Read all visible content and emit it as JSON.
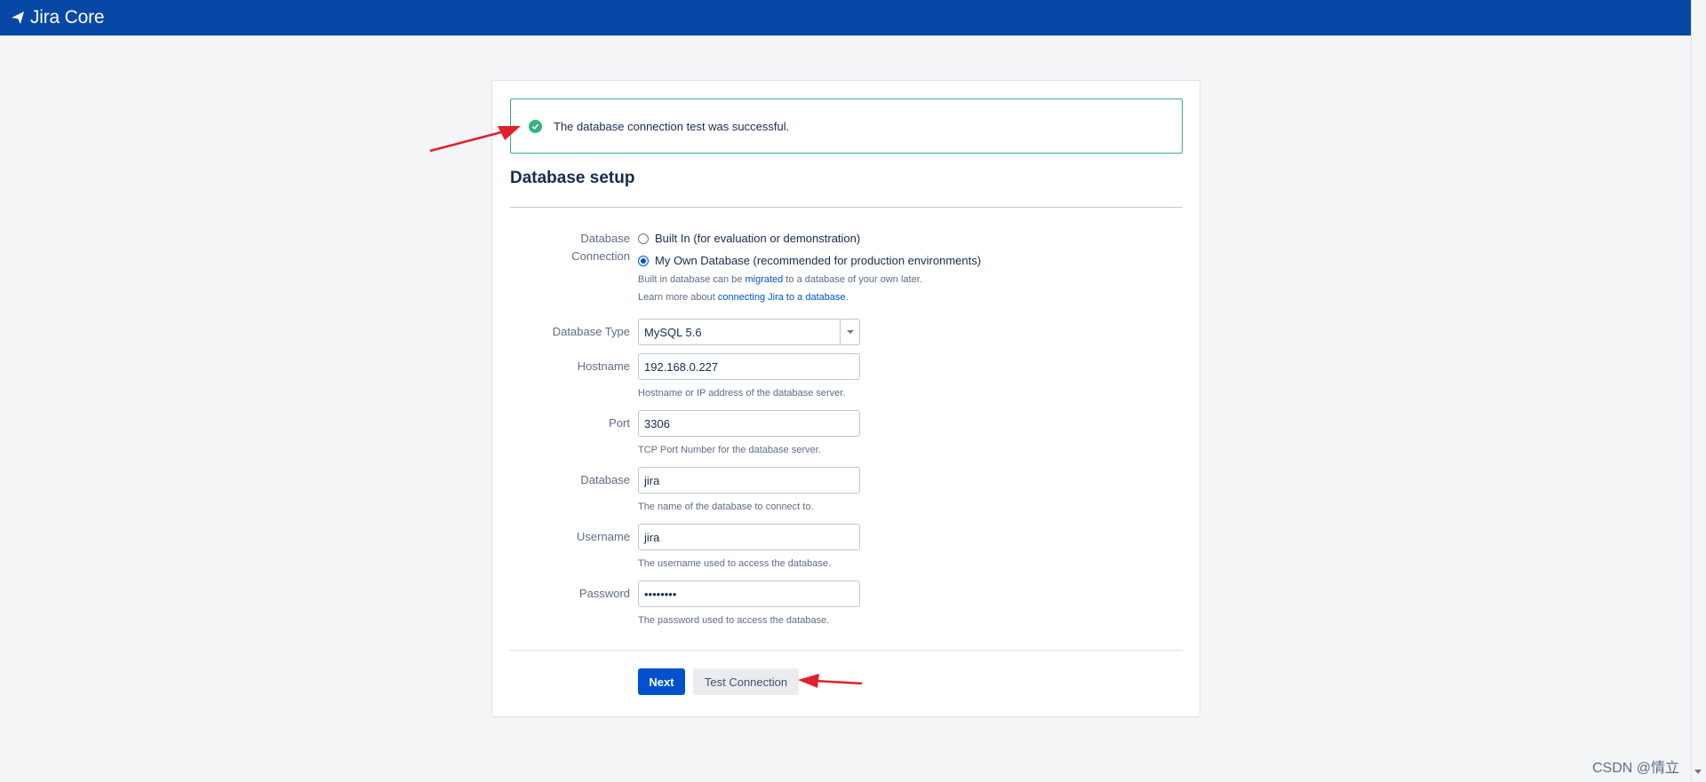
{
  "header": {
    "product_name": "Jira Core"
  },
  "alert": {
    "message": "The database connection test was successful."
  },
  "setup": {
    "title": "Database setup",
    "connection": {
      "label_line1": "Database",
      "label_line2": "Connection",
      "options": [
        {
          "label": "Built In (for evaluation or demonstration)",
          "selected": false
        },
        {
          "label": "My Own Database (recommended for production environments)",
          "selected": true
        }
      ],
      "help1_prefix": "Built in database can be ",
      "help1_link": "migrated",
      "help1_suffix": " to a database of your own later.",
      "help2_prefix": "Learn more about ",
      "help2_link": "connecting Jira to a database",
      "help2_suffix": "."
    },
    "db_type": {
      "label": "Database Type",
      "value": "MySQL 5.6"
    },
    "hostname": {
      "label": "Hostname",
      "value": "192.168.0.227",
      "help": "Hostname or IP address of the database server."
    },
    "port": {
      "label": "Port",
      "value": "3306",
      "help": "TCP Port Number for the database server."
    },
    "database": {
      "label": "Database",
      "value": "jira",
      "help": "The name of the database to connect to."
    },
    "username": {
      "label": "Username",
      "value": "jira",
      "help": "The username used to access the database."
    },
    "password": {
      "label": "Password",
      "value": "••••••••",
      "help": "The password used to access the database."
    },
    "buttons": {
      "next": "Next",
      "test": "Test Connection"
    }
  },
  "watermark": "CSDN @情立",
  "colors": {
    "topbar": "#0747a6",
    "primary": "#0052cc",
    "success": "#36b37e",
    "annotation_arrow": "#e0202a"
  },
  "icons": {
    "logo": "jira-logo-icon",
    "success": "check-circle-icon",
    "select_caret": "chevron-down-icon"
  }
}
